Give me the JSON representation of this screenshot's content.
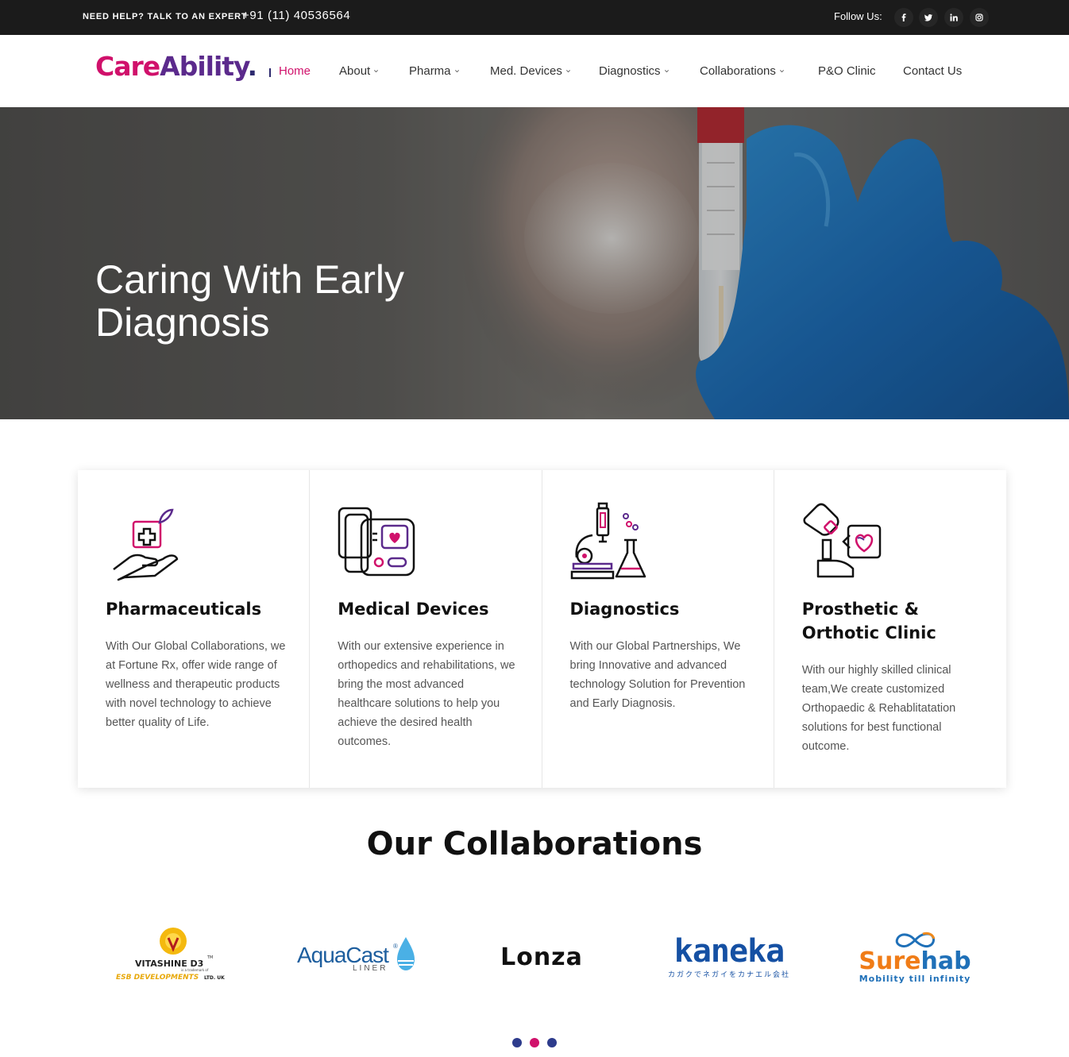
{
  "topbar": {
    "help_text": "NEED HELP? TALK TO AN EXPERT",
    "phone": "+91 (11) 40536564",
    "follow_label": "Follow Us:",
    "social": [
      "facebook-icon",
      "twitter-icon",
      "linkedin-icon",
      "instagram-icon"
    ]
  },
  "header": {
    "logo": {
      "part1": "Care",
      "part2": "Ability",
      "dot": "."
    },
    "nav": [
      {
        "label": "Home",
        "active": true
      },
      {
        "label": "About",
        "dropdown": true
      },
      {
        "label": "Pharma",
        "dropdown": true
      },
      {
        "label": "Med. Devices",
        "dropdown": true
      },
      {
        "label": "Diagnostics",
        "dropdown": true
      },
      {
        "label": "Collaborations",
        "dropdown": true
      },
      {
        "label": "P&O Clinic"
      },
      {
        "label": "Contact Us"
      }
    ]
  },
  "hero": {
    "title": "Caring With Early Diagnosis"
  },
  "services": [
    {
      "icon": "hand-medicine-icon",
      "title": "Pharmaceuticals",
      "text": "With Our Global Collaborations, we at Fortune Rx, offer wide range of wellness and therapeutic products with novel technology to achieve better quality of Life."
    },
    {
      "icon": "medical-device-icon",
      "title": "Medical Devices",
      "text": "With our extensive experience in orthopedics and rehabilitations, we bring the most advanced healthcare solutions to help you achieve the desired health outcomes."
    },
    {
      "icon": "microscope-icon",
      "title": "Diagnostics",
      "text": "With our Global Partnerships, We bring Innovative and advanced technology Solution for Prevention and Early Diagnosis."
    },
    {
      "icon": "prosthetic-icon",
      "title": "Prosthetic & Orthotic Clinic",
      "text": "With our highly skilled clinical team,We create customized Orthopaedic & Rehablitatation solutions for best functional outcome."
    }
  ],
  "collaborations": {
    "title": "Our Collaborations",
    "partners": [
      {
        "name": "VITASHINE D3",
        "tm": "TM",
        "sub1": "is a trademark of",
        "sub2": "ESB DEVELOPMENTS",
        "sub3": "LTD. UK"
      },
      {
        "name": "AquaCast",
        "reg": "®",
        "sub": "LINER"
      },
      {
        "name": "Lonza"
      },
      {
        "name": "kaneka",
        "sub": "カガクでネガイをカナエル会社"
      },
      {
        "name_a": "Sure",
        "name_b": "hab",
        "sub": "Mobility till infinity"
      }
    ],
    "pager": {
      "count": 3,
      "active_index": 1
    }
  },
  "colors": {
    "brand_pink": "#d0116b",
    "brand_purple": "#5b2a8c",
    "brand_navy": "#2d2a6e",
    "topbar_bg": "#1b1b1b"
  }
}
